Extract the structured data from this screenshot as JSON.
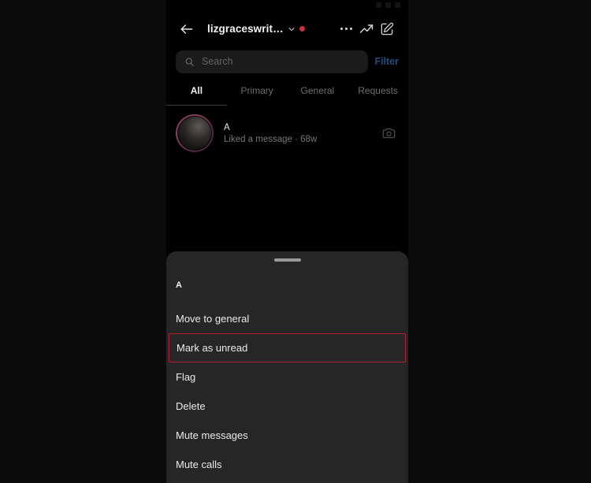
{
  "statusbar": {
    "time": "",
    "label": ""
  },
  "header": {
    "back_icon": "arrow-left-icon",
    "username": "lizgraceswrit…",
    "chevron_icon": "chevron-down-icon",
    "badge": "unread-dot",
    "more_icon": "more-horizontal-icon",
    "insights_icon": "trending-up-icon",
    "compose_icon": "compose-icon"
  },
  "search": {
    "icon": "search-icon",
    "placeholder": "Search",
    "value": "",
    "filter_label": "Filter"
  },
  "tabs": [
    {
      "label": "All",
      "active": true
    },
    {
      "label": "Primary",
      "active": false
    },
    {
      "label": "General",
      "active": false
    },
    {
      "label": "Requests",
      "active": false
    }
  ],
  "conversations": [
    {
      "avatar": "user-avatar",
      "name": "A",
      "subtitle": "Liked a message · 68w",
      "camera_icon": "camera-icon"
    }
  ],
  "sheet": {
    "handle": "drag-handle",
    "title": "A",
    "items": [
      {
        "label": "Move to general",
        "highlighted": false
      },
      {
        "label": "Mark as unread",
        "highlighted": true
      },
      {
        "label": "Flag",
        "highlighted": false
      },
      {
        "label": "Delete",
        "highlighted": false
      },
      {
        "label": "Mute messages",
        "highlighted": false
      },
      {
        "label": "Mute calls",
        "highlighted": false
      }
    ]
  },
  "colors": {
    "page_background": "#0b0b0b",
    "screen_background": "#000000",
    "sheet_background": "#262626",
    "highlight_border": "#b3202d",
    "filter_link": "#1f4e7a",
    "unread_dot": "#c9323b",
    "primary_text": "#f0f0f0",
    "secondary_text": "#767676"
  }
}
